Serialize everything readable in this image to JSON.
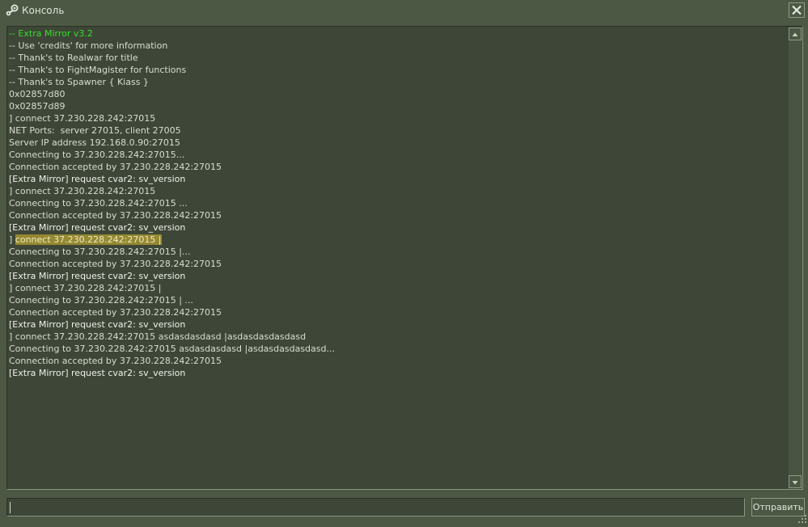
{
  "window": {
    "title": "Консоль",
    "icon": "steam-icon",
    "close_icon": "close-icon"
  },
  "console": {
    "lines": [
      {
        "text": "-- Extra Mirror v3.2",
        "color": "#34e02a",
        "highlight": false
      },
      {
        "text": "-- Use 'credits' for more information",
        "color": "#d8ded2",
        "highlight": false
      },
      {
        "text": "-- Thank's to Realwar for title",
        "color": "#d8ded2",
        "highlight": false
      },
      {
        "text": "-- Thank's to FightMagister for functions",
        "color": "#d8ded2",
        "highlight": false
      },
      {
        "text": "-- Thank's to Spawner { Kiass }",
        "color": "#d8ded2",
        "highlight": false
      },
      {
        "text": "0x02857d80",
        "color": "#d8ded2",
        "highlight": false
      },
      {
        "text": "0x02857d89",
        "color": "#d8ded2",
        "highlight": false
      },
      {
        "text": "] connect 37.230.228.242:27015",
        "color": "#d8ded2",
        "highlight": false
      },
      {
        "text": "NET Ports:  server 27015, client 27005",
        "color": "#d8ded2",
        "highlight": false
      },
      {
        "text": "Server IP address 192.168.0.90:27015",
        "color": "#d8ded2",
        "highlight": false
      },
      {
        "text": "Connecting to 37.230.228.242:27015...",
        "color": "#d8ded2",
        "highlight": false
      },
      {
        "text": "Connection accepted by 37.230.228.242:27015",
        "color": "#d8ded2",
        "highlight": false
      },
      {
        "text": "[Extra Mirror] request cvar2: sv_version",
        "color": "#eef2ea",
        "highlight": false
      },
      {
        "text": "] connect 37.230.228.242:27015",
        "color": "#d8ded2",
        "highlight": false
      },
      {
        "text": "Connecting to 37.230.228.242:27015 ...",
        "color": "#d8ded2",
        "highlight": false
      },
      {
        "text": "Connection accepted by 37.230.228.242:27015",
        "color": "#d8ded2",
        "highlight": false
      },
      {
        "text": "[Extra Mirror] request cvar2: sv_version",
        "color": "#eef2ea",
        "highlight": false
      },
      {
        "text": "] ",
        "color": "#d8ded2",
        "highlight": false,
        "highlighted_text": "connect 37.230.228.242:27015 |"
      },
      {
        "text": "Connecting to 37.230.228.242:27015 |...",
        "color": "#d8ded2",
        "highlight": false
      },
      {
        "text": "Connection accepted by 37.230.228.242:27015",
        "color": "#d8ded2",
        "highlight": false
      },
      {
        "text": "[Extra Mirror] request cvar2: sv_version",
        "color": "#eef2ea",
        "highlight": false
      },
      {
        "text": "] connect 37.230.228.242:27015 |",
        "color": "#d8ded2",
        "highlight": false
      },
      {
        "text": "Connecting to 37.230.228.242:27015 | ...",
        "color": "#d8ded2",
        "highlight": false
      },
      {
        "text": "Connection accepted by 37.230.228.242:27015",
        "color": "#d8ded2",
        "highlight": false
      },
      {
        "text": "[Extra Mirror] request cvar2: sv_version",
        "color": "#eef2ea",
        "highlight": false
      },
      {
        "text": "] connect 37.230.228.242:27015 asdasdasdasd |asdasdasdasdasd",
        "color": "#d8ded2",
        "highlight": false
      },
      {
        "text": "Connecting to 37.230.228.242:27015 asdasdasdasd |asdasdasdasdasd...",
        "color": "#d8ded2",
        "highlight": false
      },
      {
        "text": "Connection accepted by 37.230.228.242:27015",
        "color": "#d8ded2",
        "highlight": false
      },
      {
        "text": "[Extra Mirror] request cvar2: sv_version",
        "color": "#eef2ea",
        "highlight": false
      }
    ]
  },
  "input": {
    "value": ""
  },
  "send_button": {
    "label": "Отправить"
  },
  "colors": {
    "background": "#4c5844",
    "panel": "#3e4637",
    "text": "#d8ded2",
    "accent_green": "#34e02a",
    "selection": "#958831"
  }
}
